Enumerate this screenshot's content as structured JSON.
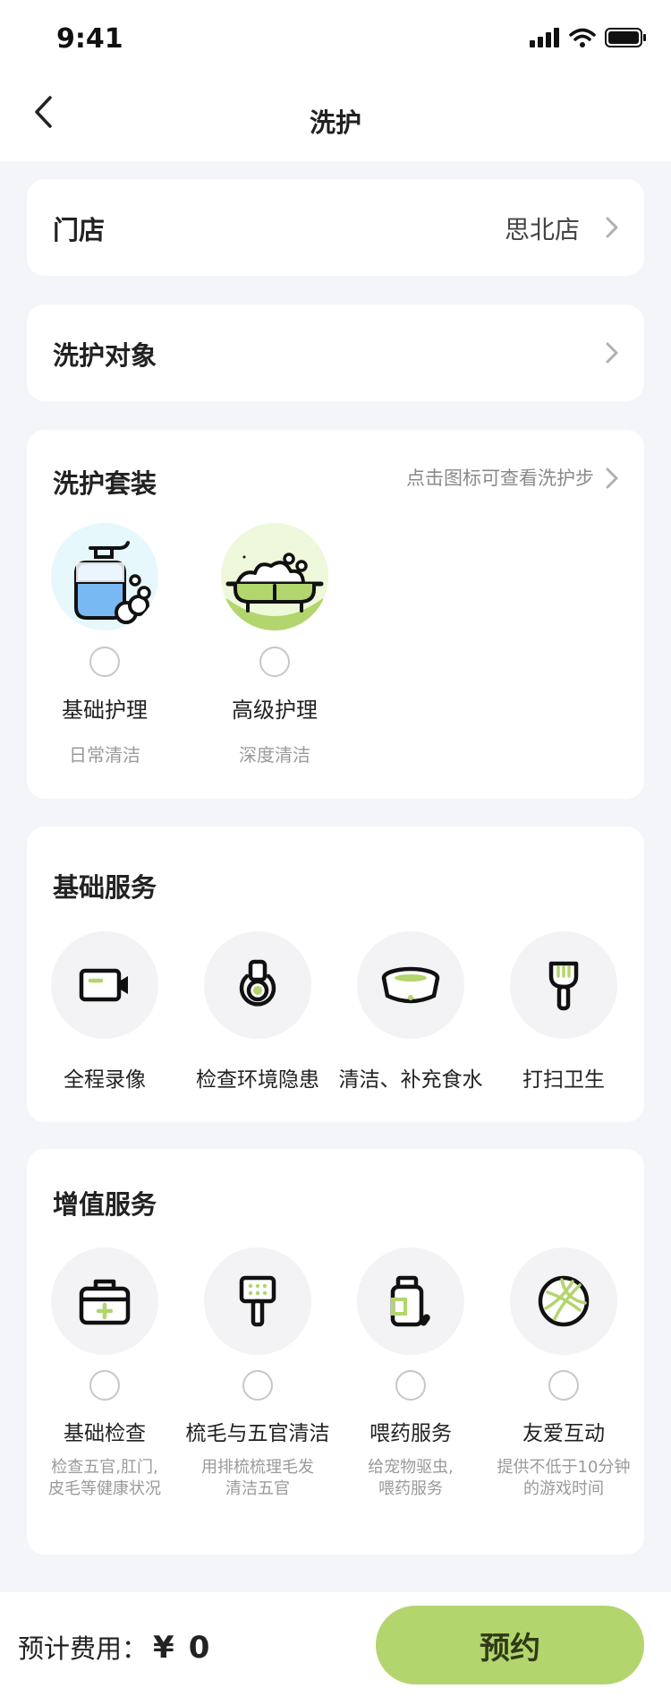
{
  "status_bar": {
    "time": "9:41"
  },
  "nav": {
    "title": "洗护"
  },
  "store": {
    "label": "门店",
    "value": "思北店"
  },
  "target": {
    "label": "洗护对象"
  },
  "package_section": {
    "title": "洗护套装",
    "hint": "点击图标可查看洗护步",
    "items": [
      {
        "name": "基础护理",
        "sub": "日常清洁",
        "icon": "soap-bottle-icon",
        "bg": "#e6f8fb"
      },
      {
        "name": "高级护理",
        "sub": "深度清洁",
        "icon": "bathtub-icon",
        "bg": "#eef8da"
      }
    ]
  },
  "basic_services": {
    "title": "基础服务",
    "items": [
      {
        "name": "全程录像",
        "icon": "video-camera-icon"
      },
      {
        "name": "检查环境隐患",
        "icon": "inspection-icon"
      },
      {
        "name": "清洁、补充食水",
        "icon": "pet-bowl-icon"
      },
      {
        "name": "打扫卫生",
        "icon": "scoop-icon"
      }
    ]
  },
  "addon_services": {
    "title": "增值服务",
    "items": [
      {
        "name": "基础检查",
        "desc": [
          "检查五官,肛门,",
          "皮毛等健康状况"
        ],
        "icon": "medical-kit-icon"
      },
      {
        "name": "梳毛与五官清洁",
        "desc": [
          "用排梳梳理毛发",
          "清洁五官"
        ],
        "icon": "comb-icon"
      },
      {
        "name": "喂药服务",
        "desc": [
          "给宠物驱虫,",
          "喂药服务"
        ],
        "icon": "medicine-bottle-icon"
      },
      {
        "name": "友爱互动",
        "desc": [
          "提供不低于10分钟",
          "的游戏时间"
        ],
        "icon": "ball-icon"
      }
    ]
  },
  "footer": {
    "cost_label": "预计费用：",
    "currency": "¥",
    "amount": "0",
    "book_label": "预约"
  },
  "colors": {
    "accent": "#b2d56d",
    "accent_text": "#2f3a17",
    "background": "#f4f5f9",
    "icon_blue": "#78b9f4"
  }
}
